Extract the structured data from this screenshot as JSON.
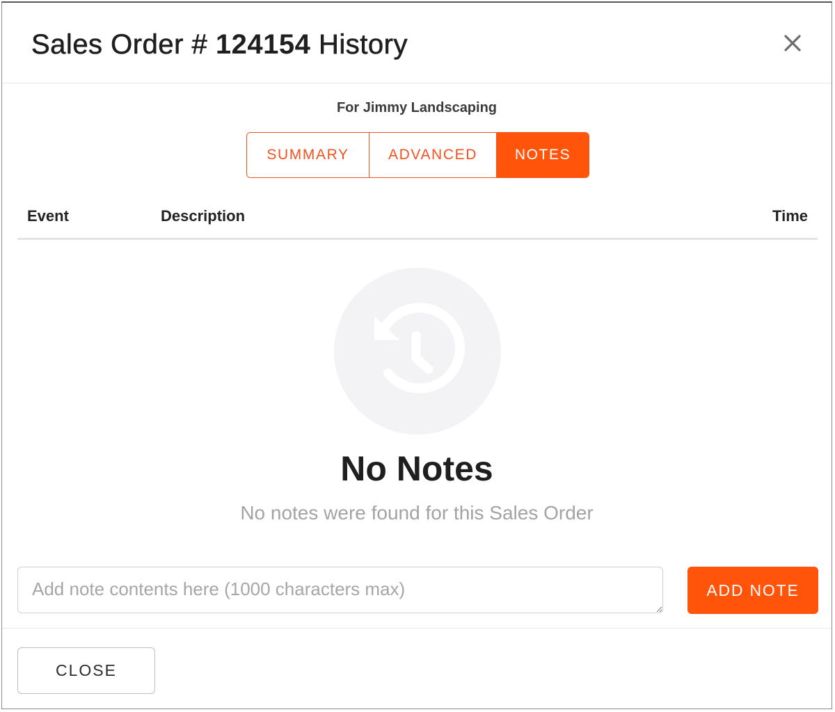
{
  "modal": {
    "title_prefix": "Sales Order # ",
    "order_number": "124154",
    "title_suffix": " History",
    "close_icon": "close-icon",
    "subtitle": "For Jimmy Landscaping"
  },
  "tabs": [
    {
      "label": "SUMMARY",
      "active": false
    },
    {
      "label": "ADVANCED",
      "active": false
    },
    {
      "label": "NOTES",
      "active": true
    }
  ],
  "table": {
    "columns": [
      "Event",
      "Description",
      "Time"
    ]
  },
  "empty_state": {
    "icon": "history-icon",
    "title": "No Notes",
    "message": "No notes were found for this Sales Order"
  },
  "note_form": {
    "value": "",
    "placeholder": "Add note contents here (1000 characters max)",
    "add_label": "ADD NOTE"
  },
  "footer": {
    "close_label": "CLOSE"
  },
  "colors": {
    "accent": "#ff5409",
    "accent_border": "#f4511e",
    "empty_circle": "#f3f3f5",
    "muted_text": "#a3a3a3"
  }
}
